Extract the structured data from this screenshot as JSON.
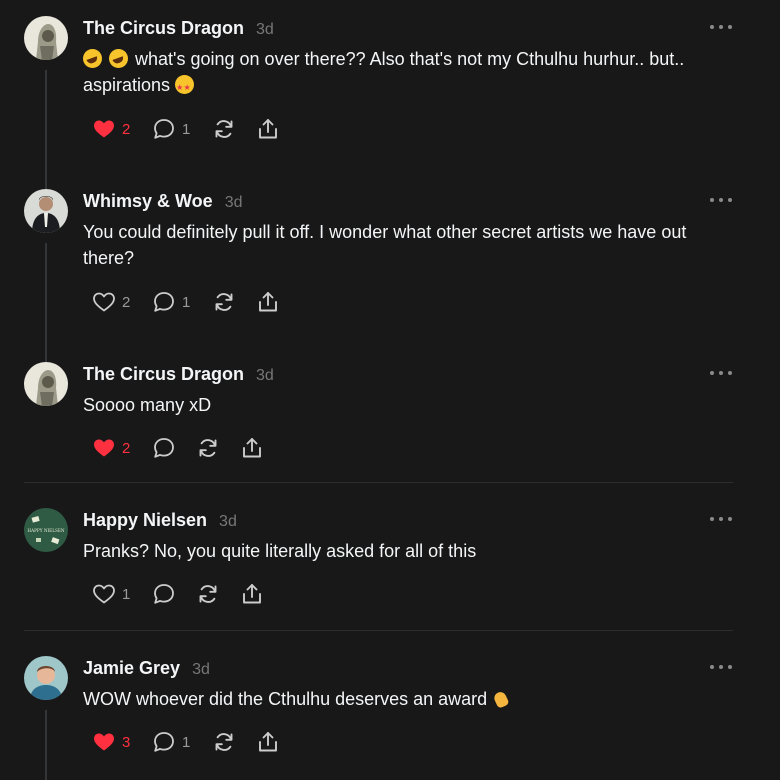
{
  "posts": [
    {
      "username": "The Circus Dragon",
      "time": "3d",
      "text_parts": [
        "what's going on over there?? Also that's not my Cthulhu hurhur.. but.. aspirations"
      ],
      "likes": "2",
      "liked": true,
      "replies": "1"
    },
    {
      "username": "Whimsy & Woe",
      "time": "3d",
      "text": "You could definitely pull it off. I wonder what other secret artists we have out there?",
      "likes": "2",
      "liked": false,
      "replies": "1"
    },
    {
      "username": "The Circus Dragon",
      "time": "3d",
      "text": "Soooo many xD",
      "likes": "2",
      "liked": true,
      "replies": ""
    },
    {
      "username": "Happy Nielsen",
      "time": "3d",
      "text": "Pranks? No, you quite literally asked for all of this",
      "likes": "1",
      "liked": false,
      "replies": ""
    },
    {
      "username": "Jamie Grey",
      "time": "3d",
      "text": "WOW whoever did the Cthulhu deserves an award",
      "likes": "3",
      "liked": true,
      "replies": "1"
    }
  ],
  "avatar_text": {
    "happy_nielsen": "HAPPY NIELSEN"
  },
  "icons": {
    "like": "heart-icon",
    "reply": "reply-icon",
    "repost": "repost-icon",
    "share": "share-icon",
    "more": "more-icon",
    "emojis": [
      "rofl-emoji",
      "starstruck-emoji",
      "clap-emoji"
    ]
  },
  "colors": {
    "background": "#181818",
    "text": "#f3f5f7",
    "muted": "#777777",
    "liked": "#ff3040",
    "icon": "#cccccc"
  }
}
